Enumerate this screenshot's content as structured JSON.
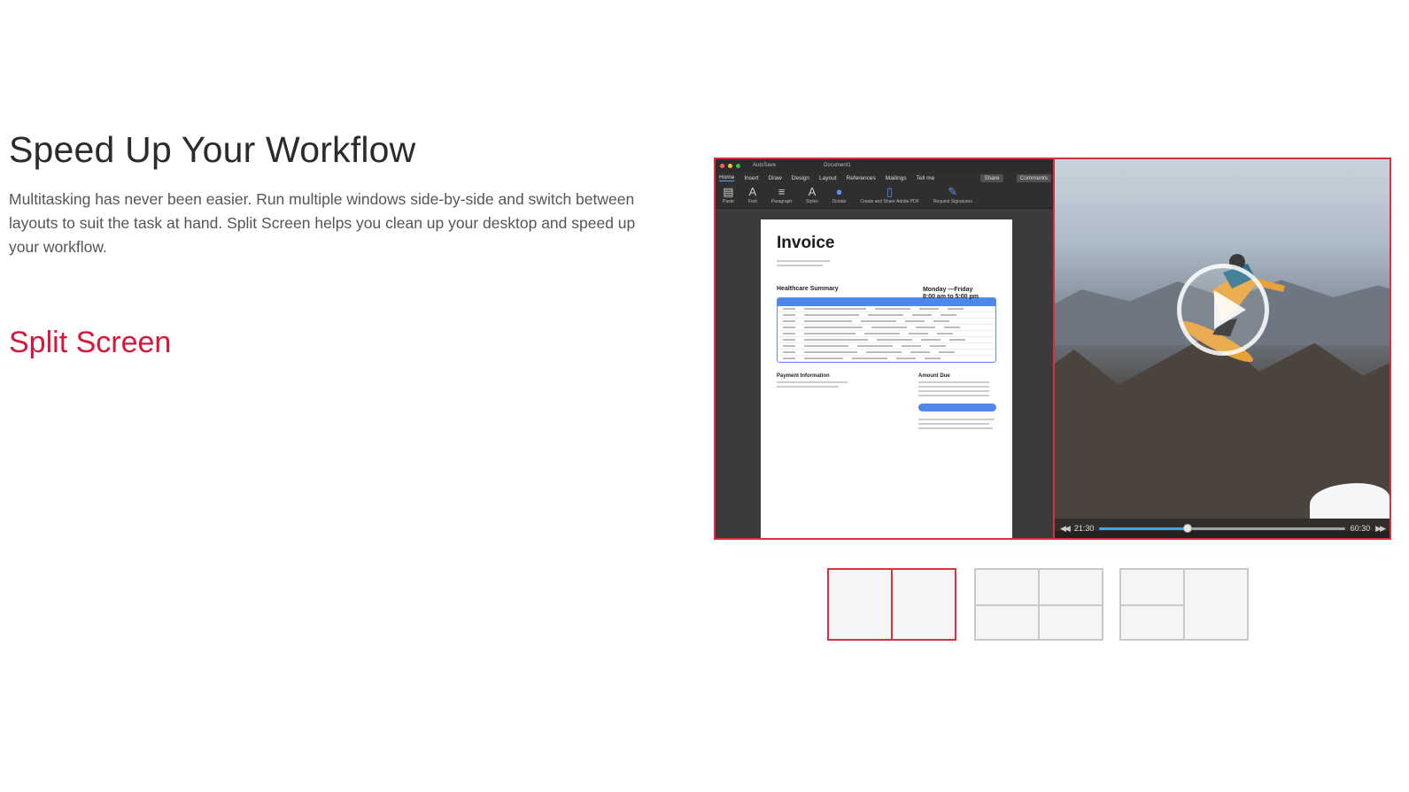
{
  "hero": {
    "title": "Speed Up Your Workflow",
    "description": "Multitasking has never been easier. Run multiple windows side-by-side and switch between layouts to suit the task at hand. Split Screen helps you clean up your desktop and speed up your workflow."
  },
  "section": {
    "title": "Split Screen"
  },
  "demo": {
    "word": {
      "window_title": "Document1",
      "autosave_label": "AutoSave",
      "tabs": [
        "Home",
        "Insert",
        "Draw",
        "Design",
        "Layout",
        "References",
        "Mailings",
        "Tell me"
      ],
      "share_label": "Share",
      "comments_label": "Comments",
      "ribbon": [
        "Paste",
        "Font",
        "Paragraph",
        "Styles",
        "Dictate",
        "Create and Share Adobe PDF",
        "Request Signatures"
      ],
      "document": {
        "title": "Invoice",
        "hours_line1": "Monday —Friday",
        "hours_line2": "8:00 am to 5:00 pm",
        "section1": "Healthcare Summary",
        "section2": "Payment Information",
        "section3": "Amount Due"
      }
    },
    "video": {
      "time_current": "21:30",
      "time_total": "60:30",
      "progress_percent": 36
    },
    "accent_color": "#d8303f"
  },
  "layouts": {
    "selected_index": 0,
    "options": [
      "two-columns",
      "four-grid",
      "one-left-two-right"
    ]
  }
}
